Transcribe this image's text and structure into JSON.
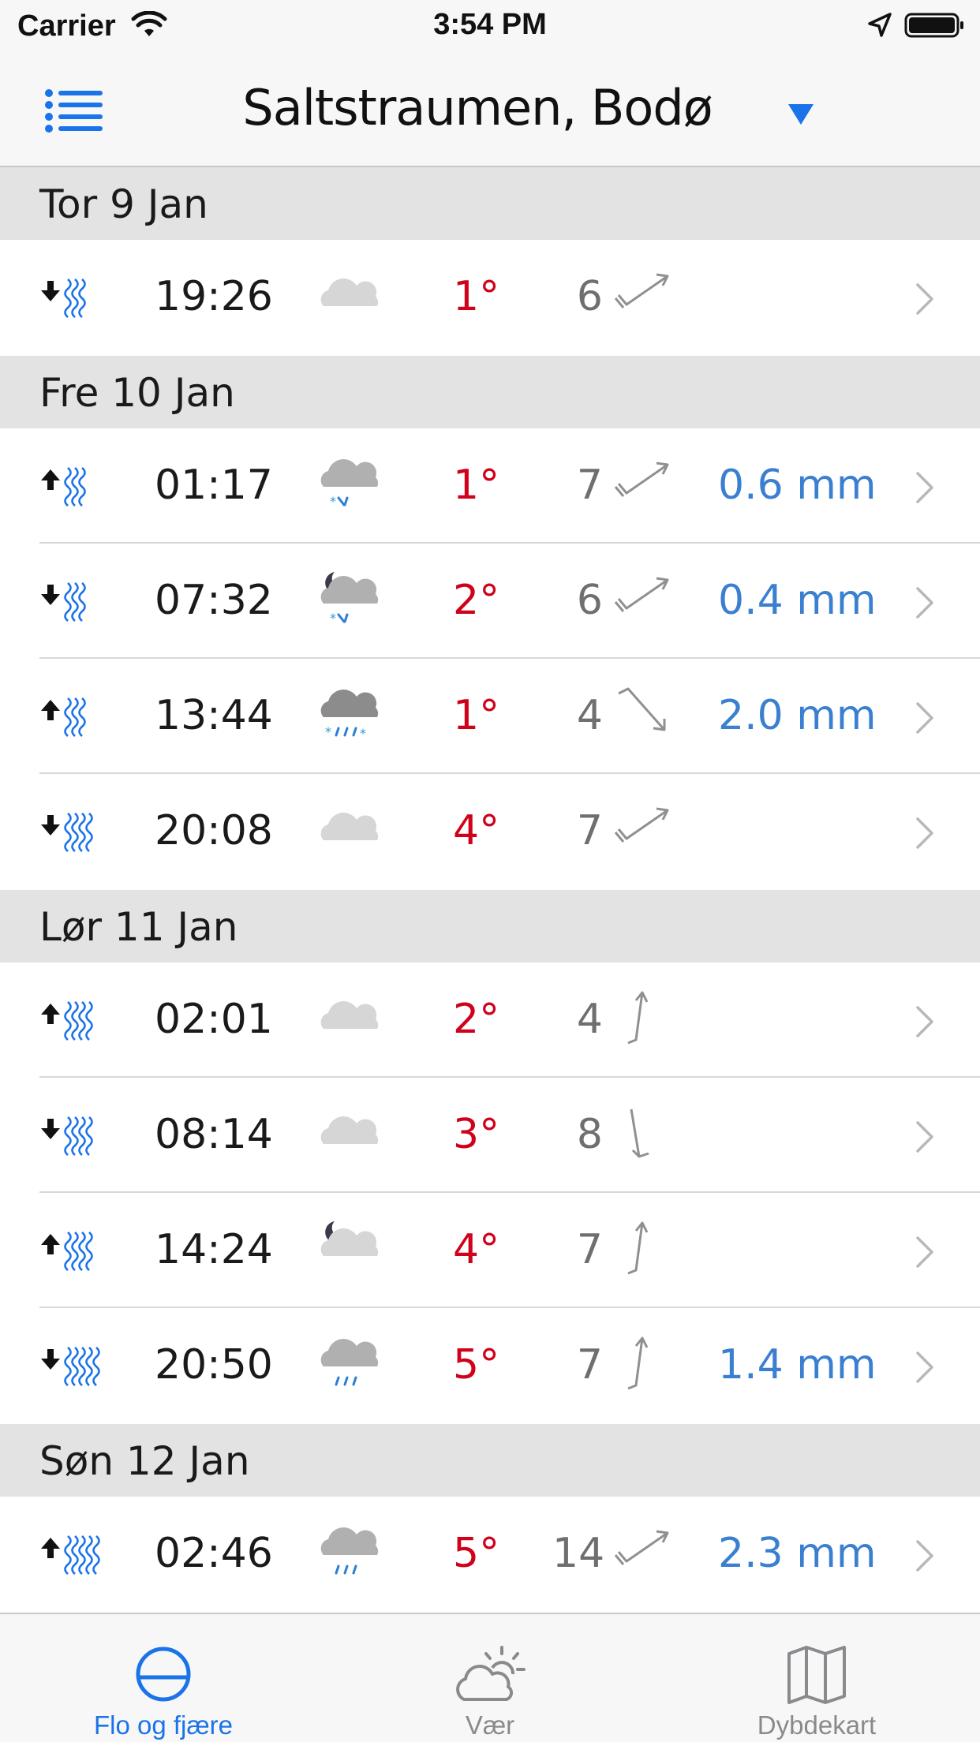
{
  "status_bar": {
    "carrier": "Carrier",
    "time": "3:54 PM"
  },
  "nav": {
    "title": "Saltstraumen, Bodø",
    "menu_icon": "list-icon",
    "dropdown_icon": "triangle-down-icon"
  },
  "colors": {
    "accent": "#1a73e8",
    "temp": "#d0021b",
    "precip": "#3a7fd0",
    "wind": "#6f6f6f",
    "section_bg": "#e3e3e3"
  },
  "sections": [
    {
      "title": "Tor 9 Jan",
      "rows": [
        {
          "tide": "down",
          "waves": 3,
          "time": "19:26",
          "weather": "cloudy-light",
          "temp": "1°",
          "wind": "6",
          "wind_dir": "arrow-up-right",
          "precip": ""
        }
      ]
    },
    {
      "title": "Fre 10 Jan",
      "rows": [
        {
          "tide": "up",
          "waves": 3,
          "time": "01:17",
          "weather": "sleet",
          "temp": "1°",
          "wind": "7",
          "wind_dir": "arrow-up-right",
          "precip": "0.6 mm"
        },
        {
          "tide": "down",
          "waves": 3,
          "time": "07:32",
          "weather": "night-sleet",
          "temp": "2°",
          "wind": "6",
          "wind_dir": "arrow-up-right",
          "precip": "0.4 mm"
        },
        {
          "tide": "up",
          "waves": 3,
          "time": "13:44",
          "weather": "heavy-sleet",
          "temp": "1°",
          "wind": "4",
          "wind_dir": "arrow-down-right",
          "precip": "2.0 mm"
        },
        {
          "tide": "down",
          "waves": 4,
          "time": "20:08",
          "weather": "cloudy-light",
          "temp": "4°",
          "wind": "7",
          "wind_dir": "arrow-up-right",
          "precip": ""
        }
      ]
    },
    {
      "title": "Lør 11 Jan",
      "rows": [
        {
          "tide": "up",
          "waves": 4,
          "time": "02:01",
          "weather": "cloudy-light",
          "temp": "2°",
          "wind": "4",
          "wind_dir": "arrow-up",
          "precip": ""
        },
        {
          "tide": "down",
          "waves": 4,
          "time": "08:14",
          "weather": "cloudy-light",
          "temp": "3°",
          "wind": "8",
          "wind_dir": "arrow-down",
          "precip": ""
        },
        {
          "tide": "up",
          "waves": 4,
          "time": "14:24",
          "weather": "night-cloudy",
          "temp": "4°",
          "wind": "7",
          "wind_dir": "arrow-up",
          "precip": ""
        },
        {
          "tide": "down",
          "waves": 5,
          "time": "20:50",
          "weather": "rain",
          "temp": "5°",
          "wind": "7",
          "wind_dir": "arrow-up",
          "precip": "1.4 mm"
        }
      ]
    },
    {
      "title": "Søn 12 Jan",
      "rows": [
        {
          "tide": "up",
          "waves": 5,
          "time": "02:46",
          "weather": "rain",
          "temp": "5°",
          "wind": "14",
          "wind_dir": "arrow-up-right",
          "precip": "2.3 mm"
        }
      ]
    }
  ],
  "tabs": [
    {
      "label": "Flo og fjære",
      "icon": "tide-circle-icon",
      "active": true
    },
    {
      "label": "Vær",
      "icon": "sun-cloud-icon",
      "active": false
    },
    {
      "label": "Dybdekart",
      "icon": "map-icon",
      "active": false
    }
  ]
}
